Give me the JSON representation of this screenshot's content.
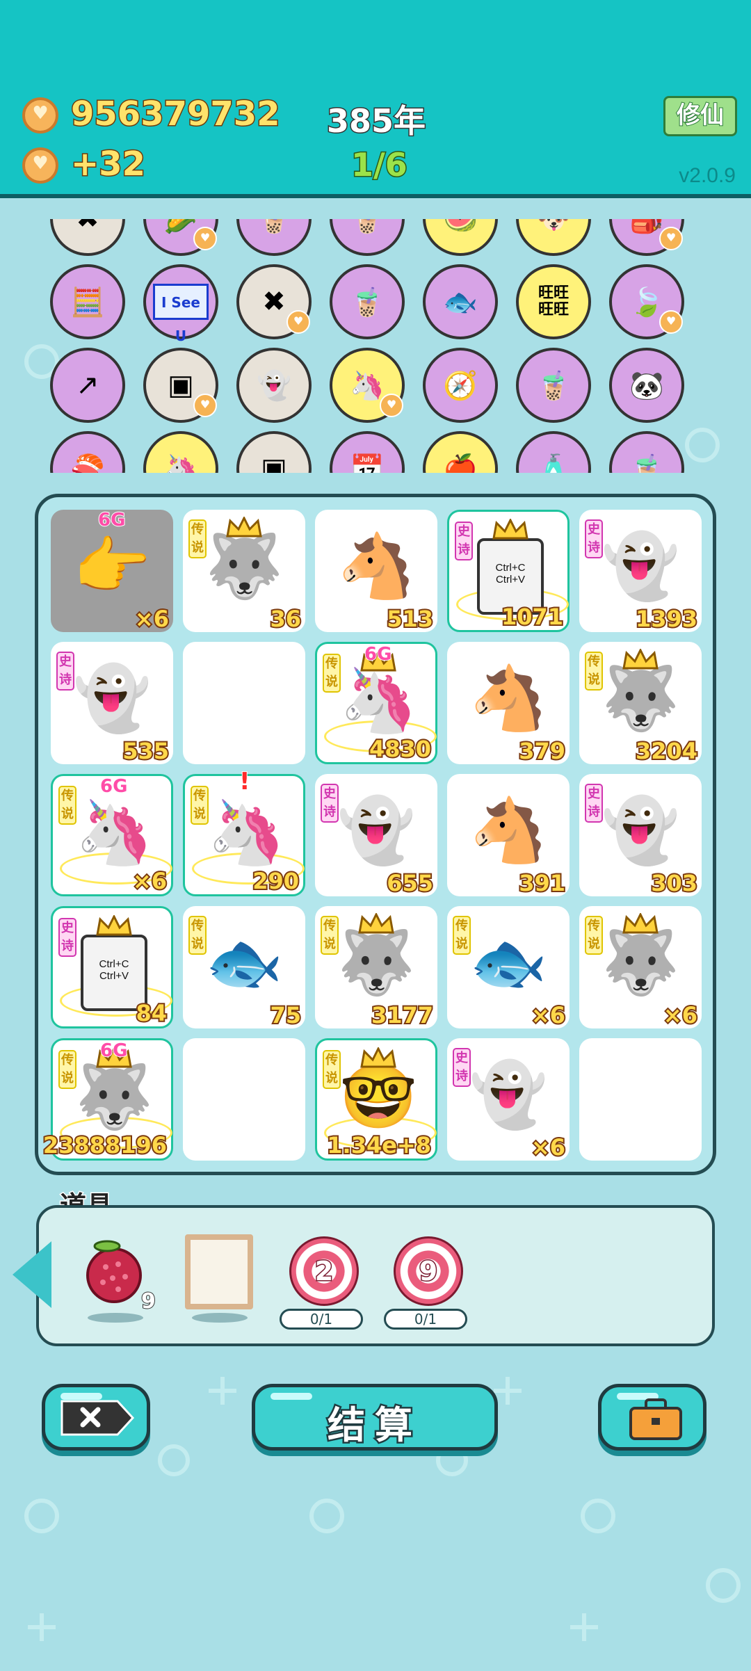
{
  "header": {
    "coins": "956379732",
    "income": "+32",
    "year": "385年",
    "level": "1/6",
    "cultivate_button": "修仙",
    "version": "v2.0.9"
  },
  "icon_strip": {
    "rows": [
      [
        "cancel-x",
        "corn",
        "bubble-tea",
        "bubble-tea",
        "watermelon",
        "dog",
        "red-bag"
      ],
      [
        "math-kid",
        "I See U",
        "cancel-x",
        "bubble-tea",
        "fish-bowl",
        "旺旺",
        "leaf"
      ],
      [
        "arrow-up",
        "cubes",
        "wink-ghost",
        "unicorn",
        "compass",
        "bubble-tea",
        "panda"
      ],
      [
        "sushi",
        "unicorn",
        "cubes",
        "calendar",
        "fruit-basket",
        "spray-bottle",
        "bubble-tea"
      ]
    ],
    "see_u_text": "I See U",
    "wang_text": "旺"
  },
  "board": {
    "cells": [
      {
        "item": "hand-pointer",
        "badge": "",
        "tag": "6G",
        "value": "×6",
        "highlight": false,
        "gray": true
      },
      {
        "item": "husky-crown",
        "badge": "传说",
        "tag": "",
        "value": "36",
        "highlight": false
      },
      {
        "item": "horse",
        "badge": "",
        "tag": "",
        "value": "513",
        "highlight": false
      },
      {
        "item": "ctrl-cv",
        "badge": "史诗",
        "tag": "",
        "value": "1071",
        "highlight": true
      },
      {
        "item": "ghost",
        "badge": "史诗",
        "tag": "",
        "value": "1393",
        "highlight": false
      },
      {
        "item": "ghost",
        "badge": "史诗",
        "tag": "",
        "value": "535",
        "highlight": false
      },
      {
        "item": "empty",
        "badge": "",
        "tag": "",
        "value": "",
        "highlight": false
      },
      {
        "item": "unicorn-crown",
        "badge": "传说",
        "tag": "6G",
        "value": "4830",
        "highlight": true
      },
      {
        "item": "horse",
        "badge": "",
        "tag": "",
        "value": "379",
        "highlight": false
      },
      {
        "item": "husky-crown",
        "badge": "传说",
        "tag": "",
        "value": "3204",
        "highlight": false
      },
      {
        "item": "unicorn",
        "badge": "传说",
        "tag": "6G",
        "value": "×6",
        "highlight": true
      },
      {
        "item": "unicorn",
        "badge": "传说",
        "tag": "!",
        "value": "290",
        "highlight": true
      },
      {
        "item": "ghost",
        "badge": "史诗",
        "tag": "",
        "value": "655",
        "highlight": false
      },
      {
        "item": "horse",
        "badge": "",
        "tag": "",
        "value": "391",
        "highlight": false
      },
      {
        "item": "ghost",
        "badge": "史诗",
        "tag": "",
        "value": "303",
        "highlight": false
      },
      {
        "item": "ctrl-cv",
        "badge": "史诗",
        "tag": "",
        "value": "84",
        "highlight": true
      },
      {
        "item": "koi",
        "badge": "传说",
        "tag": "",
        "value": "75",
        "highlight": false
      },
      {
        "item": "husky-crown",
        "badge": "传说",
        "tag": "",
        "value": "3177",
        "highlight": false
      },
      {
        "item": "koi",
        "badge": "传说",
        "tag": "",
        "value": "×6",
        "highlight": false
      },
      {
        "item": "husky-crown",
        "badge": "传说",
        "tag": "",
        "value": "×6",
        "highlight": false
      },
      {
        "item": "husky-crown",
        "badge": "传说",
        "tag": "6G",
        "value": "23888196",
        "highlight": true
      },
      {
        "item": "empty",
        "badge": "",
        "tag": "",
        "value": "",
        "highlight": false
      },
      {
        "item": "king-face",
        "badge": "传说",
        "tag": "",
        "value": "1.34e+8",
        "highlight": true
      },
      {
        "item": "ghost",
        "badge": "史诗",
        "tag": "",
        "value": "×6",
        "highlight": false
      },
      {
        "item": "empty",
        "badge": "",
        "tag": "",
        "value": "",
        "highlight": false
      }
    ],
    "ctrl_text": "Ctrl+C\nCtrl+V"
  },
  "props": {
    "label": "道具",
    "lychee_count": "9",
    "target1_num": "2",
    "target1_progress": "0/1",
    "target2_num": "9",
    "target2_progress": "0/1"
  },
  "footer": {
    "settle_label": "结算"
  },
  "colors": {
    "teal": "#15c4c4",
    "background": "#a9dfe6",
    "gold_text": "#ffe36b",
    "level_green": "#9be24a",
    "legend_badge": "#fff6a8",
    "epic_badge": "#ffd7f3"
  }
}
